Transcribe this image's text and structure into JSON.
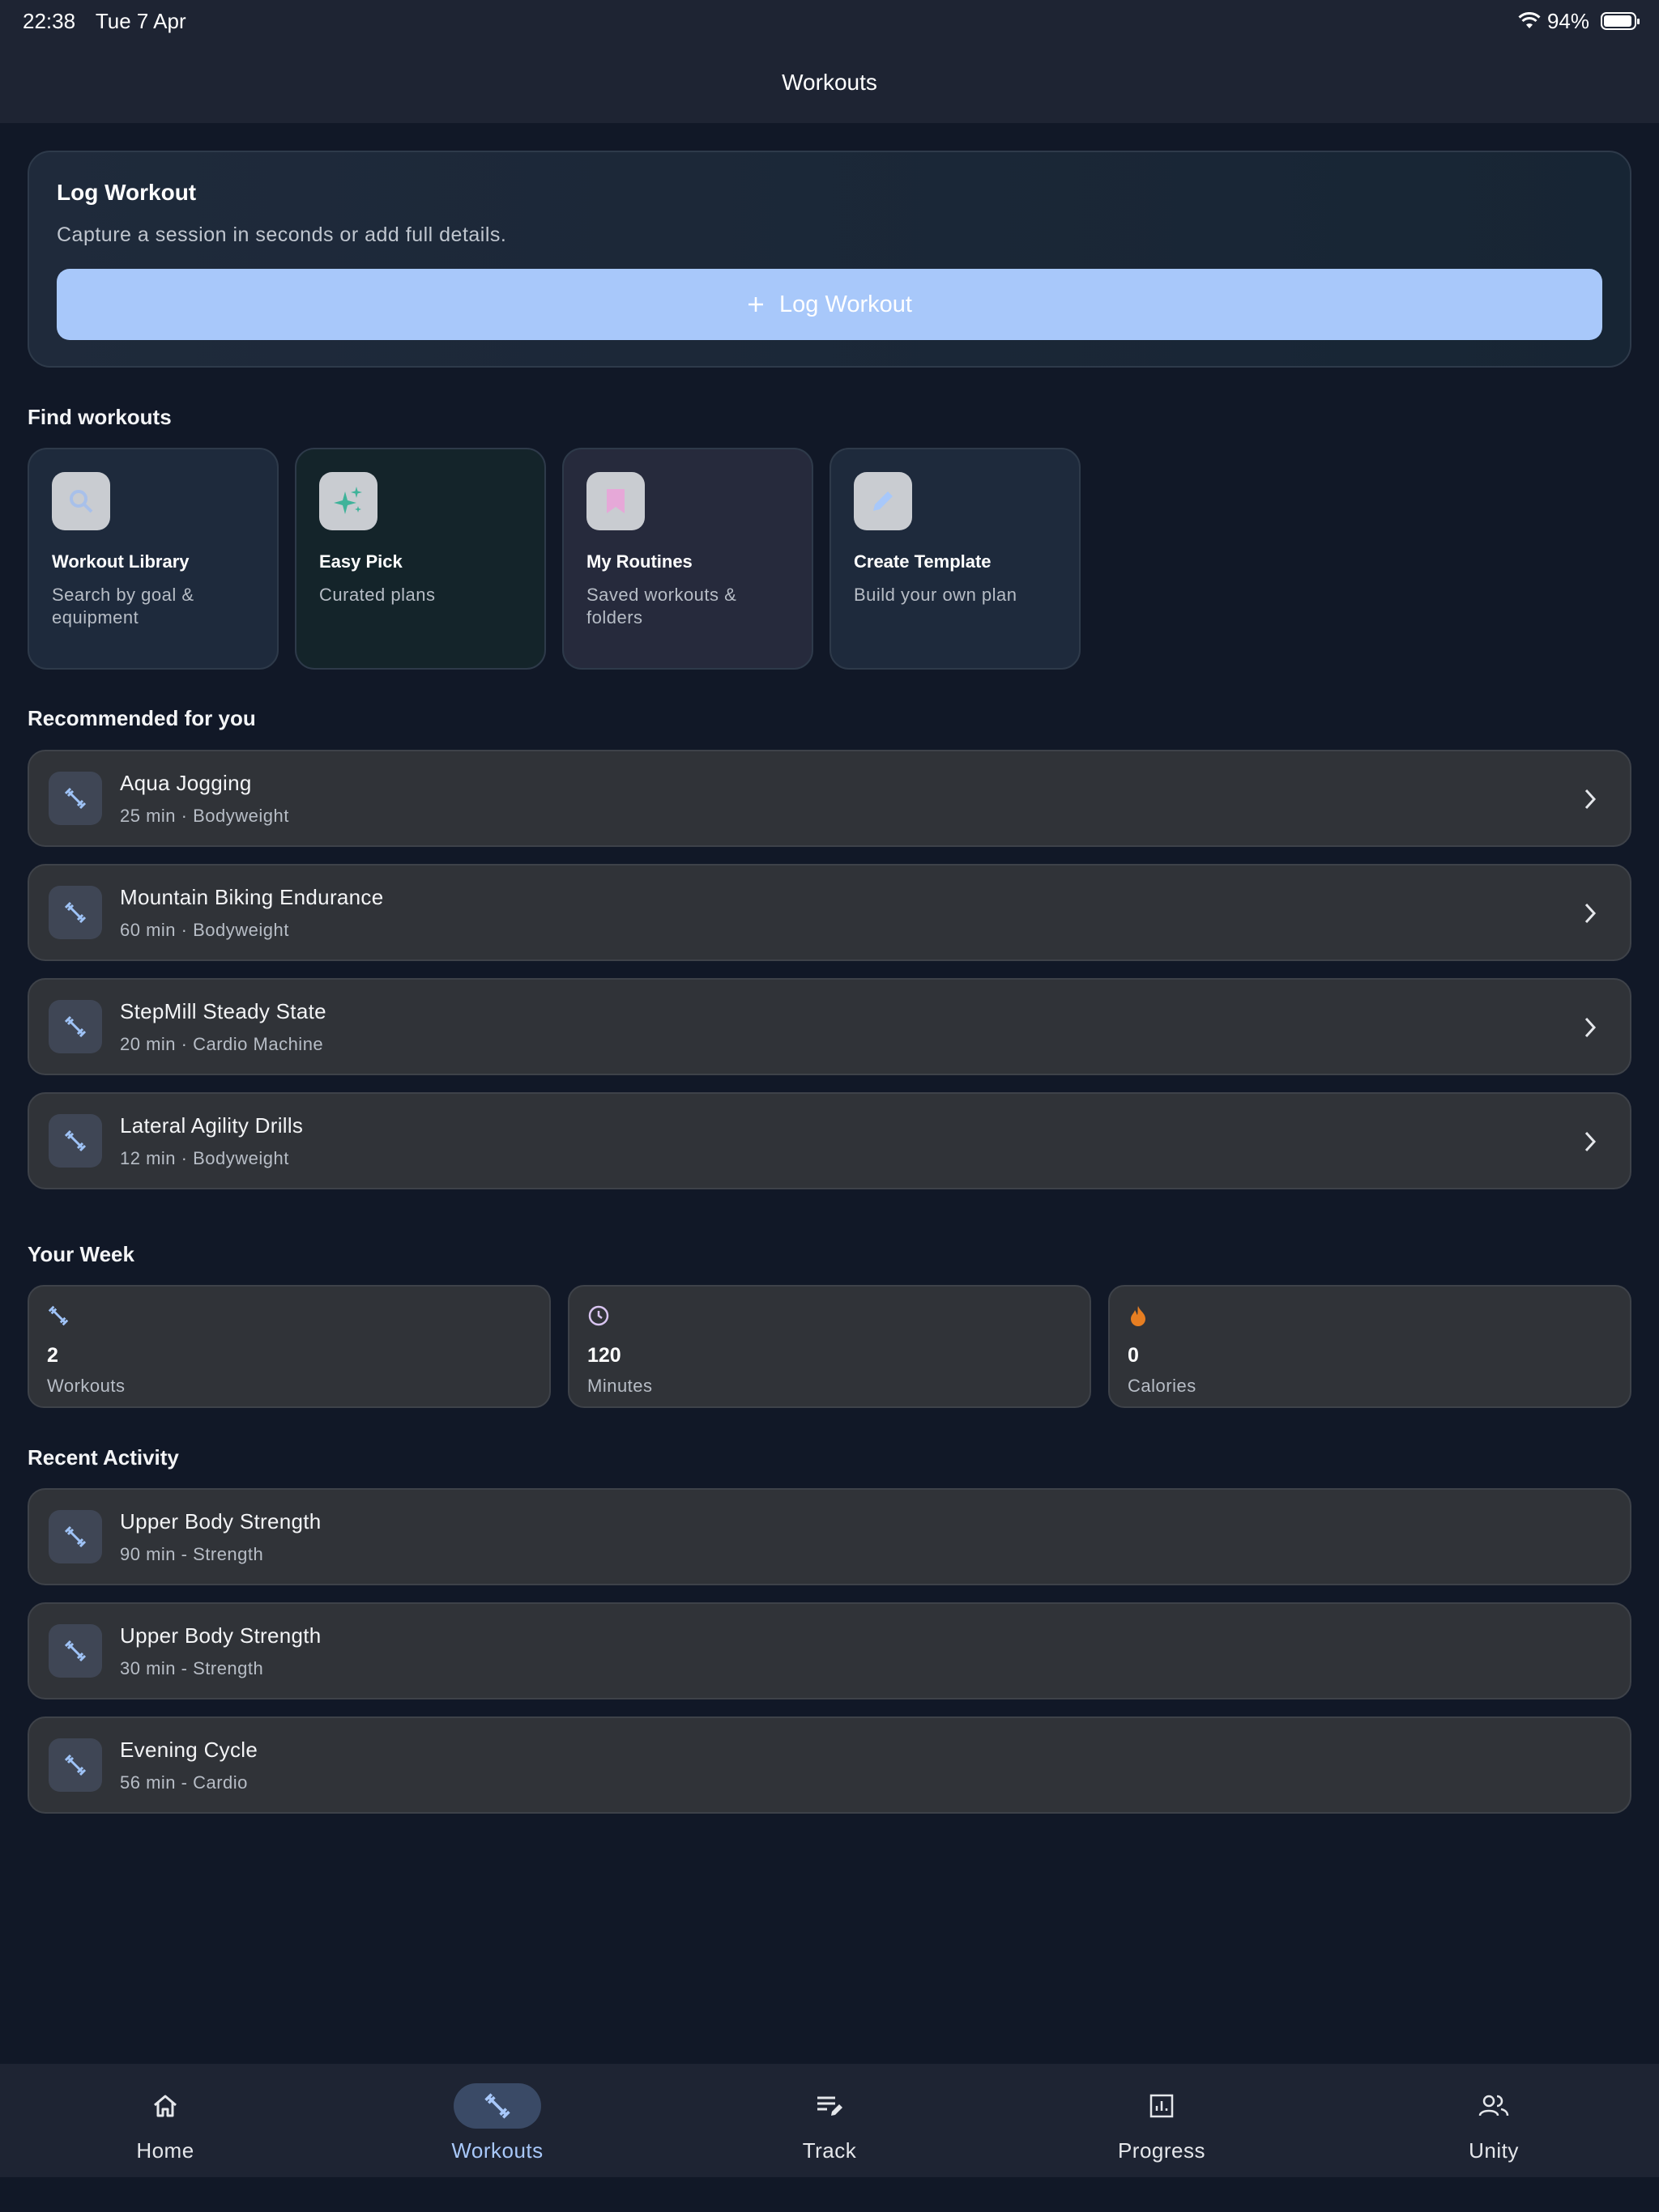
{
  "status_bar": {
    "time": "22:38",
    "date": "Tue 7 Apr",
    "battery": "94%"
  },
  "header": {
    "title": "Workouts"
  },
  "log_card": {
    "title": "Log Workout",
    "subtitle": "Capture a session in seconds or add full details.",
    "button_label": "Log Workout",
    "button_icon": "plus-icon"
  },
  "find": {
    "title": "Find workouts",
    "items": [
      {
        "title": "Workout Library",
        "desc": "Search by goal & equipment",
        "icon": "search-icon",
        "bg": "#1e2a3c"
      },
      {
        "title": "Easy Pick",
        "desc": "Curated plans",
        "icon": "sparkles-icon",
        "bg": "#14242a"
      },
      {
        "title": "My Routines",
        "desc": "Saved workouts & folders",
        "icon": "bookmark-icon",
        "bg": "#262a3c"
      },
      {
        "title": "Create Template",
        "desc": "Build your own plan",
        "icon": "pencil-icon",
        "bg": "#1e2a3c"
      }
    ]
  },
  "recommended": {
    "title": "Recommended for you",
    "items": [
      {
        "name": "Aqua Jogging",
        "meta": "25 min · Bodyweight"
      },
      {
        "name": "Mountain Biking Endurance",
        "meta": "60 min · Bodyweight"
      },
      {
        "name": "StepMill Steady State",
        "meta": "20 min · Cardio Machine"
      },
      {
        "name": "Lateral Agility Drills",
        "meta": "12 min · Bodyweight"
      }
    ]
  },
  "week": {
    "title": "Your Week",
    "stats": [
      {
        "value": "2",
        "label": "Workouts",
        "icon": "dumbbell-icon",
        "color": "#9fc3f7"
      },
      {
        "value": "120",
        "label": "Minutes",
        "icon": "clock-icon",
        "color": "#d8c4f0"
      },
      {
        "value": "0",
        "label": "Calories",
        "icon": "flame-icon",
        "color": "#e67e22"
      }
    ]
  },
  "recent": {
    "title": "Recent Activity",
    "items": [
      {
        "name": "Upper Body Strength",
        "meta": "90 min - Strength"
      },
      {
        "name": "Upper Body Strength",
        "meta": "30 min - Strength"
      },
      {
        "name": "Evening Cycle",
        "meta": "56 min - Cardio"
      }
    ]
  },
  "tabs": [
    {
      "label": "Home",
      "icon": "home-icon",
      "active": false
    },
    {
      "label": "Workouts",
      "icon": "dumbbell-icon",
      "active": true
    },
    {
      "label": "Track",
      "icon": "track-icon",
      "active": false
    },
    {
      "label": "Progress",
      "icon": "chart-icon",
      "active": false
    },
    {
      "label": "Unity",
      "icon": "people-icon",
      "active": false
    }
  ],
  "colors": {
    "accent": "#a8c8fa",
    "background": "#111827",
    "surface": "#303338"
  }
}
